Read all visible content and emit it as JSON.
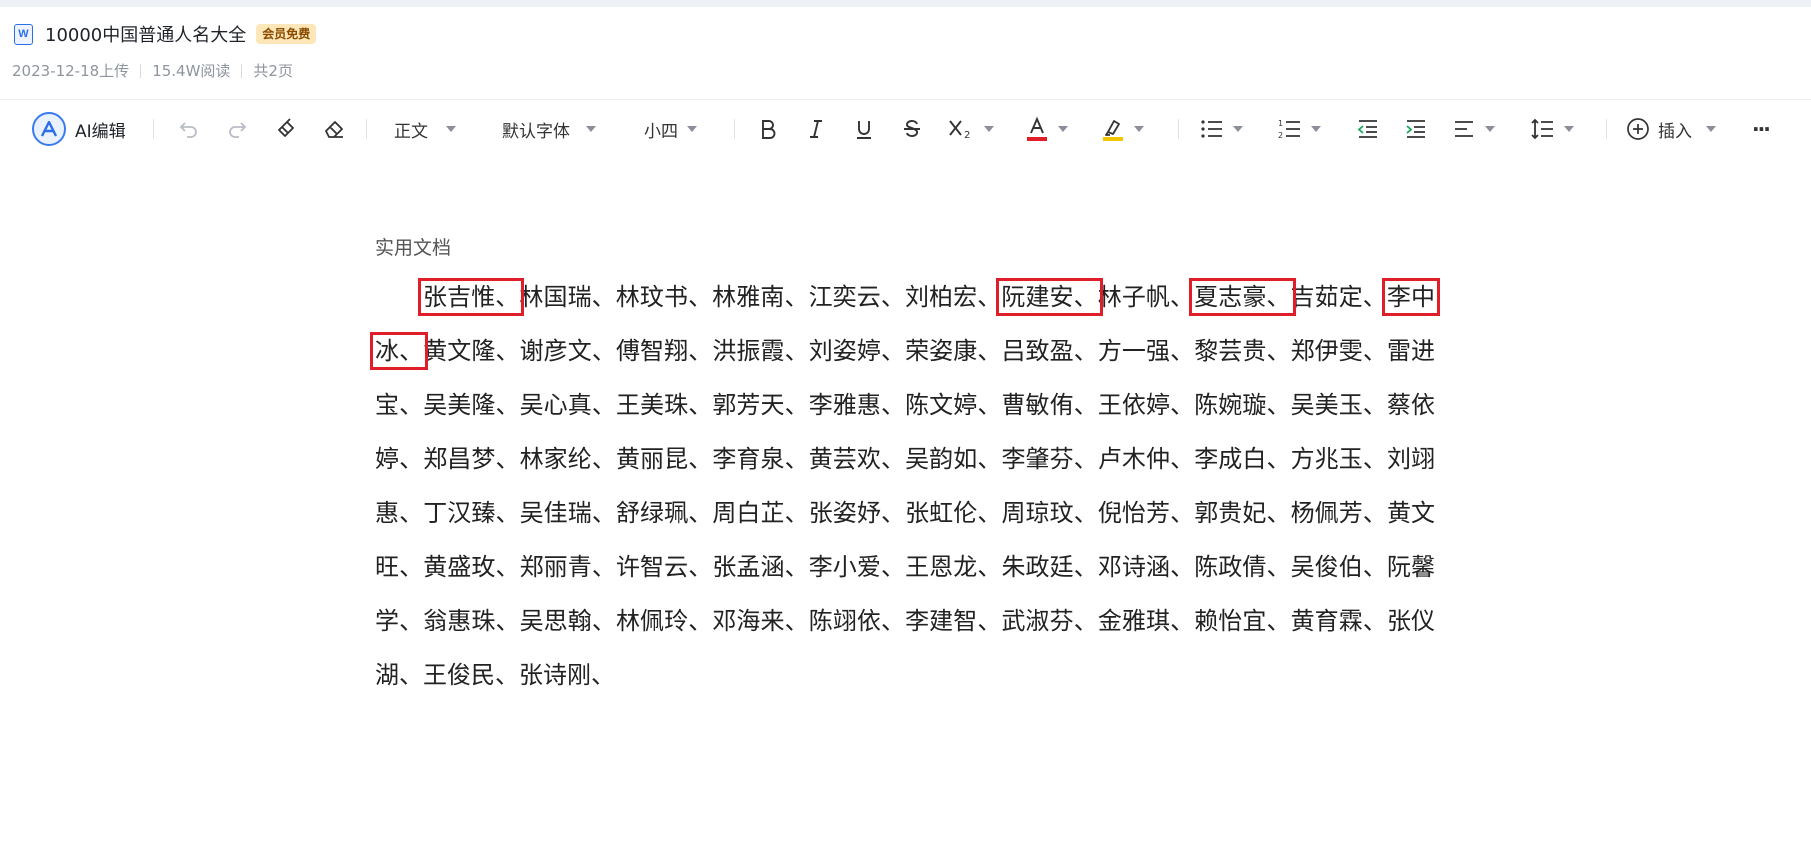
{
  "document": {
    "file_type_icon": "W",
    "title": "10000中国普通人名大全",
    "badge": "会员免费",
    "upload_date": "2023-12-18上传",
    "read_count": "15.4W阅读",
    "page_count": "共2页"
  },
  "toolbar": {
    "ai_label": "AI编辑",
    "style_select": "正文",
    "font_select": "默认字体",
    "size_select": "小四",
    "insert_label": "插入",
    "more_glyph": "···",
    "font_color": "#e01e2a",
    "highlight_color": "#f2c500"
  },
  "content": {
    "header": "实用文档",
    "names": [
      {
        "text": "张吉惟、",
        "marked": true
      },
      {
        "text": "林国瑞、",
        "marked": false
      },
      {
        "text": "林玟书、",
        "marked": false
      },
      {
        "text": "林雅南、",
        "marked": false
      },
      {
        "text": "江奕云、",
        "marked": false
      },
      {
        "text": "刘柏宏、",
        "marked": false
      },
      {
        "text": "阮建安、",
        "marked": true
      },
      {
        "text": "林子帆、",
        "marked": false
      },
      {
        "text": "夏志豪、",
        "marked": true
      },
      {
        "text": "吉茹定、",
        "marked": false
      },
      {
        "text": "李中冰、",
        "marked": true
      },
      {
        "text": "黄文隆、",
        "marked": false
      },
      {
        "text": "谢彦文、",
        "marked": false
      },
      {
        "text": "傅智翔、",
        "marked": false
      },
      {
        "text": "洪振霞、",
        "marked": false
      },
      {
        "text": "刘姿婷、",
        "marked": false
      },
      {
        "text": "荣姿康、",
        "marked": false
      },
      {
        "text": "吕致盈、",
        "marked": false
      },
      {
        "text": "方一强、",
        "marked": false
      },
      {
        "text": "黎芸贵、",
        "marked": false
      },
      {
        "text": "郑伊雯、",
        "marked": false
      },
      {
        "text": "雷进宝、",
        "marked": false
      },
      {
        "text": "吴美隆、",
        "marked": false
      },
      {
        "text": "吴心真、",
        "marked": false
      },
      {
        "text": "王美珠、",
        "marked": false
      },
      {
        "text": "郭芳天、",
        "marked": false
      },
      {
        "text": "李雅惠、",
        "marked": false
      },
      {
        "text": "陈文婷、",
        "marked": false
      },
      {
        "text": "曹敏侑、",
        "marked": false
      },
      {
        "text": "王依婷、",
        "marked": false
      },
      {
        "text": "陈婉璇、",
        "marked": false
      },
      {
        "text": "吴美玉、",
        "marked": false
      },
      {
        "text": "蔡依婷、",
        "marked": false
      },
      {
        "text": "郑昌梦、",
        "marked": false
      },
      {
        "text": "林家纶、",
        "marked": false
      },
      {
        "text": "黄丽昆、",
        "marked": false
      },
      {
        "text": "李育泉、",
        "marked": false
      },
      {
        "text": "黄芸欢、",
        "marked": false
      },
      {
        "text": "吴韵如、",
        "marked": false
      },
      {
        "text": "李肇芬、",
        "marked": false
      },
      {
        "text": "卢木仲、",
        "marked": false
      },
      {
        "text": "李成白、",
        "marked": false
      },
      {
        "text": "方兆玉、",
        "marked": false
      },
      {
        "text": "刘翊惠、",
        "marked": false
      },
      {
        "text": "丁汉臻、",
        "marked": false
      },
      {
        "text": "吴佳瑞、",
        "marked": false
      },
      {
        "text": "舒绿珮、",
        "marked": false
      },
      {
        "text": "周白芷、",
        "marked": false
      },
      {
        "text": "张姿妤、",
        "marked": false
      },
      {
        "text": "张虹伦、",
        "marked": false
      },
      {
        "text": "周琼玟、",
        "marked": false
      },
      {
        "text": "倪怡芳、",
        "marked": false
      },
      {
        "text": "郭贵妃、",
        "marked": false
      },
      {
        "text": "杨佩芳、",
        "marked": false
      },
      {
        "text": "黄文旺、",
        "marked": false
      },
      {
        "text": "黄盛玫、",
        "marked": false
      },
      {
        "text": "郑丽青、",
        "marked": false
      },
      {
        "text": "许智云、",
        "marked": false
      },
      {
        "text": "张孟涵、",
        "marked": false
      },
      {
        "text": "李小爱、",
        "marked": false
      },
      {
        "text": "王恩龙、",
        "marked": false
      },
      {
        "text": "朱政廷、",
        "marked": false
      },
      {
        "text": "邓诗涵、",
        "marked": false
      },
      {
        "text": "陈政倩、",
        "marked": false
      },
      {
        "text": "吴俊伯、",
        "marked": false
      },
      {
        "text": "阮馨学、",
        "marked": false
      },
      {
        "text": "翁惠珠、",
        "marked": false
      },
      {
        "text": "吴思翰、",
        "marked": false
      },
      {
        "text": "林佩玲、",
        "marked": false
      },
      {
        "text": "邓海来、",
        "marked": false
      },
      {
        "text": "陈翊依、",
        "marked": false
      },
      {
        "text": "李建智、",
        "marked": false
      },
      {
        "text": "武淑芬、",
        "marked": false
      },
      {
        "text": "金雅琪、",
        "marked": false
      },
      {
        "text": "赖怡宜、",
        "marked": false
      },
      {
        "text": "黄育霖、",
        "marked": false
      },
      {
        "text": "张仪湖、",
        "marked": false
      },
      {
        "text": "王俊民、",
        "marked": false
      },
      {
        "text": "张诗刚、",
        "marked": false
      }
    ]
  }
}
